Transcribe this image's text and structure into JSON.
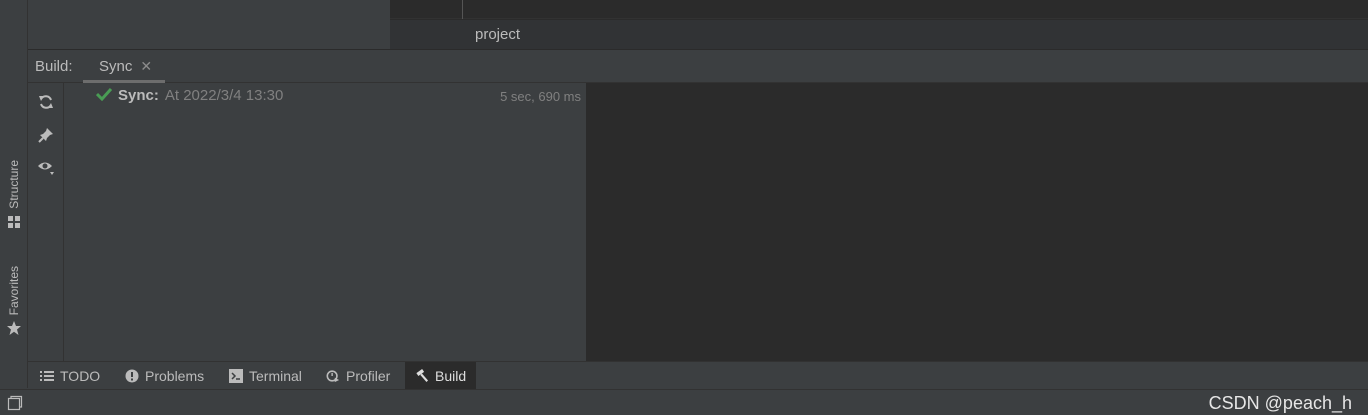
{
  "editor": {
    "project_label": "project"
  },
  "left_strip": {
    "structure_label": "Structure",
    "favorites_label": "Favorites"
  },
  "build_window": {
    "title": "Build:",
    "tabs": [
      {
        "label": "Sync",
        "closable": true,
        "active": true
      }
    ],
    "toolbar_icons": [
      "sync-icon",
      "pin-icon",
      "eye-icon"
    ],
    "tree": {
      "status_icon": "checkmark-icon",
      "status_color": "#499c54",
      "name": "Sync:",
      "timestamp": "At 2022/3/4 13:30",
      "duration": "5 sec, 690 ms"
    }
  },
  "bottom_tabs": [
    {
      "label": "TODO",
      "icon": "list-icon",
      "active": false
    },
    {
      "label": "Problems",
      "icon": "info-icon",
      "active": false
    },
    {
      "label": "Terminal",
      "icon": "terminal-icon",
      "active": false
    },
    {
      "label": "Profiler",
      "icon": "profiler-icon",
      "active": false
    },
    {
      "label": "Build",
      "icon": "hammer-icon",
      "active": true
    }
  ],
  "status_bar": {
    "watermark": "CSDN @peach_h"
  },
  "colors": {
    "panel_bg": "#3c3f41",
    "editor_bg": "#2b2b2b",
    "text": "#bbbbbb",
    "success": "#499c54"
  }
}
